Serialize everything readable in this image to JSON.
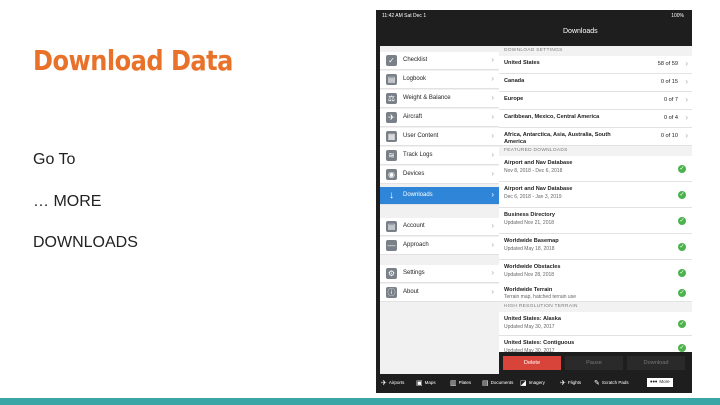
{
  "slide": {
    "title": "Download Data",
    "lines": [
      "Go To",
      "… MORE",
      "DOWNLOADS"
    ]
  },
  "device": {
    "status": {
      "time": "11:42 AM   Sat Dec 1",
      "battery": "100%"
    },
    "nav_title": "Downloads",
    "sidebar": [
      {
        "label": "Checklist",
        "icon": "checklist-icon",
        "glyph": "✓"
      },
      {
        "label": "Logbook",
        "icon": "logbook-icon",
        "glyph": "▤"
      },
      {
        "label": "Weight & Balance",
        "icon": "weight-icon",
        "glyph": "⚖"
      },
      {
        "label": "Aircraft",
        "icon": "aircraft-icon",
        "glyph": "✈"
      },
      {
        "label": "User Content",
        "icon": "user-content-icon",
        "glyph": "▦"
      },
      {
        "label": "Track Logs",
        "icon": "track-logs-icon",
        "glyph": "≋"
      },
      {
        "label": "Devices",
        "icon": "devices-icon",
        "glyph": "◉"
      },
      {
        "label": "Downloads",
        "icon": "download-icon",
        "glyph": "↓",
        "active": true
      },
      {
        "label": "Account",
        "icon": "account-icon",
        "glyph": "▤"
      },
      {
        "label": "Approach",
        "icon": "approach-icon",
        "glyph": "—"
      },
      {
        "label": "Settings",
        "icon": "settings-icon",
        "glyph": "⚙"
      },
      {
        "label": "About",
        "icon": "about-icon",
        "glyph": "ⓘ"
      }
    ],
    "sections": {
      "settings": "DOWNLOAD SETTINGS",
      "featured": "FEATURED DOWNLOADS",
      "terrain": "HIGH RESOLUTION TERRAIN"
    },
    "regions": [
      {
        "name": "United States",
        "count": "58 of 59"
      },
      {
        "name": "Canada",
        "count": "0 of 15"
      },
      {
        "name": "Europe",
        "count": "0 of 7"
      },
      {
        "name": "Caribbean, Mexico, Central America",
        "count": "0 of 4"
      },
      {
        "name": "Africa, Antarctica, Asia, Australia, South America",
        "count": "0 of 10"
      }
    ],
    "featured": [
      {
        "name": "Airport and Nav Database",
        "sub": "Nov 8, 2018 - Dec 6, 2018"
      },
      {
        "name": "Airport and Nav Database",
        "sub": "Dec 6, 2018 - Jan 3, 2019"
      },
      {
        "name": "Business Directory",
        "sub": "Updated Nov 21, 2018"
      },
      {
        "name": "Worldwide Basemap",
        "sub": "Updated May 18, 2018"
      },
      {
        "name": "Worldwide Obstacles",
        "sub": "Updated Nov 28, 2018"
      },
      {
        "name": "Worldwide Terrain",
        "sub": "Terrain map, hatched terrain use"
      }
    ],
    "terrain": [
      {
        "name": "United States: Alaska",
        "sub": "Updated May 30, 2017"
      },
      {
        "name": "United States: Contiguous",
        "sub": "Updated May 30, 2017"
      }
    ],
    "actions": {
      "delete": "Delete",
      "pause": "Pause",
      "download": "Download"
    },
    "tabs": [
      {
        "label": "Airports",
        "icon": "airports-icon",
        "glyph": "✈"
      },
      {
        "label": "Maps",
        "icon": "maps-icon",
        "glyph": "▣"
      },
      {
        "label": "Plates",
        "icon": "plates-icon",
        "glyph": "▥"
      },
      {
        "label": "Documents",
        "icon": "documents-icon",
        "glyph": "▤"
      },
      {
        "label": "Imagery",
        "icon": "imagery-icon",
        "glyph": "◪"
      },
      {
        "label": "Flights",
        "icon": "flights-icon",
        "glyph": "✈"
      },
      {
        "label": "Scratch Pads",
        "icon": "scratchpads-icon",
        "glyph": "✎"
      },
      {
        "label": "More",
        "icon": "more-icon",
        "glyph": "•••"
      }
    ]
  },
  "colors": {
    "title": "#e8722a",
    "accent": "#2f86d8",
    "delete": "#d9443a",
    "check": "#4bb34b",
    "bar": "#3aa6a6"
  }
}
